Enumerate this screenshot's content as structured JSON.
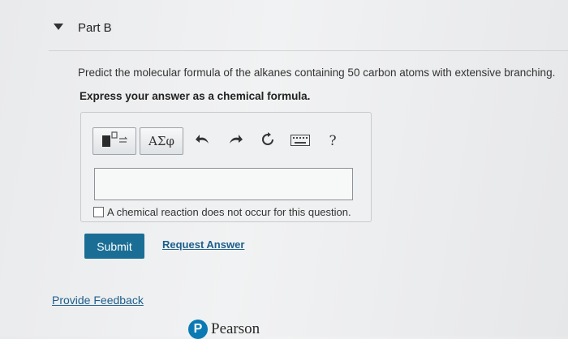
{
  "part": {
    "title": "Part B"
  },
  "question": {
    "text": "Predict the molecular formula of the alkanes containing 50 carbon atoms with extensive branching.",
    "instruction": "Express your answer as a chemical formula."
  },
  "toolbar": {
    "greek_label": "ΑΣφ",
    "help_label": "?",
    "icons": [
      "templates-icon",
      "greek-letters-icon",
      "undo-icon",
      "redo-icon",
      "reset-icon",
      "keyboard-icon",
      "help-icon"
    ]
  },
  "answer": {
    "value": ""
  },
  "no_reaction": {
    "label": "A chemical reaction does not occur for this question."
  },
  "actions": {
    "submit_label": "Submit",
    "request_answer_label": "Request Answer"
  },
  "footer": {
    "feedback_label": "Provide Feedback",
    "brand_name": "Pearson"
  },
  "colors": {
    "submit": "#1a6e95",
    "link": "#1c5f8c",
    "brand": "#0b7ab4"
  }
}
